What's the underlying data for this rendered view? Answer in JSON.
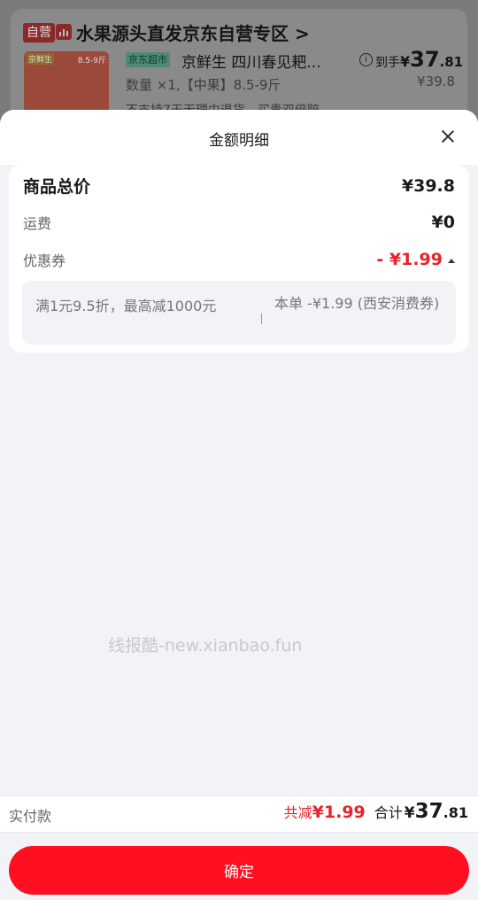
{
  "background": {
    "self_run_tag": "自营",
    "shop_name": "水果源头直发京东自营专区 >",
    "product_image": {
      "label_brand": "京鲜生",
      "label_weight": "8.5-9斤"
    },
    "channel_badge": "京东超市",
    "product_title": "京鲜生 四川春见耙...",
    "final_price_label": "到手",
    "final_price_currency": "¥",
    "final_price_int": "37",
    "final_price_dec": ".81",
    "original_price": "¥39.8",
    "quantity_spec": "数量 ×1,【中果】8.5-9斤",
    "note": "不支持7天无理由退货，买贵双倍赔"
  },
  "sheet": {
    "title": "金额明细",
    "goods_total_label": "商品总价",
    "goods_total_value": "¥39.8",
    "shipping_label": "运费",
    "shipping_value": "¥0",
    "coupon_label": "优惠券",
    "coupon_value": "- ¥1.99",
    "coupon_detail_rule": "满1元9.5折，最高减1000元",
    "coupon_detail_applied": "本单 -¥1.99 (西安消费券)"
  },
  "watermark": "线报酷-new.xianbao.fun",
  "footer": {
    "pay_label": "实付款",
    "saved_label": "共减",
    "saved_value": "¥1.99",
    "sum_label": "合计",
    "sum_currency": "¥",
    "sum_int": "37",
    "sum_dec": ".81"
  },
  "confirm_label": "确定",
  "colors": {
    "accent": "#ff1020",
    "discount": "#e8232a"
  }
}
